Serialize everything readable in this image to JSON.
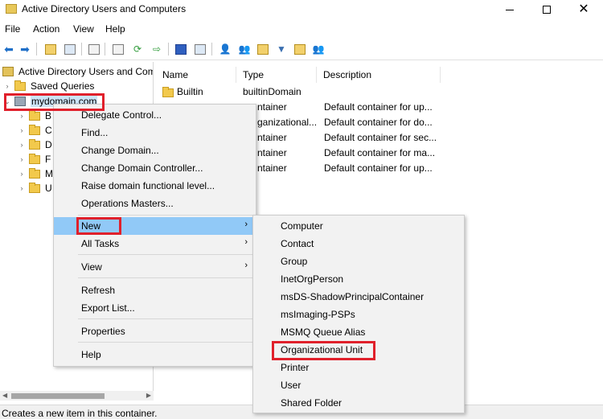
{
  "window": {
    "title": "Active Directory Users and Computers"
  },
  "menubar": {
    "items": [
      "File",
      "Action",
      "View",
      "Help"
    ]
  },
  "tree": {
    "root": "Active Directory Users and Com",
    "saved_queries": "Saved Queries",
    "domain": "mydomain.com",
    "children": [
      "B",
      "C",
      "D",
      "F",
      "M",
      "U"
    ]
  },
  "list": {
    "columns": {
      "name": "Name",
      "type": "Type",
      "description": "Description"
    },
    "rows": [
      {
        "name": "Builtin",
        "type": "builtinDomain",
        "description": ""
      },
      {
        "name": "",
        "type": "ntainer",
        "description": "Default container for up..."
      },
      {
        "name": "",
        "type": "ganizational...",
        "description": "Default container for do..."
      },
      {
        "name": "",
        "type": "ntainer",
        "description": "Default container for sec..."
      },
      {
        "name": "",
        "type": "ntainer",
        "description": "Default container for ma..."
      },
      {
        "name": "",
        "type": "ntainer",
        "description": "Default container for up..."
      }
    ]
  },
  "context_menu": {
    "items": [
      "Delegate Control...",
      "Find...",
      "Change Domain...",
      "Change Domain Controller...",
      "Raise domain functional level...",
      "Operations Masters...",
      "New",
      "All Tasks",
      "View",
      "Refresh",
      "Export List...",
      "Properties",
      "Help"
    ]
  },
  "submenu": {
    "items": [
      "Computer",
      "Contact",
      "Group",
      "InetOrgPerson",
      "msDS-ShadowPrincipalContainer",
      "msImaging-PSPs",
      "MSMQ Queue Alias",
      "Organizational Unit",
      "Printer",
      "User",
      "Shared Folder"
    ]
  },
  "status": {
    "text": "Creates a new item in this container."
  },
  "colors": {
    "highlight": "#91c9f7",
    "annotation": "#e0202b",
    "folder": "#f2c94c"
  }
}
